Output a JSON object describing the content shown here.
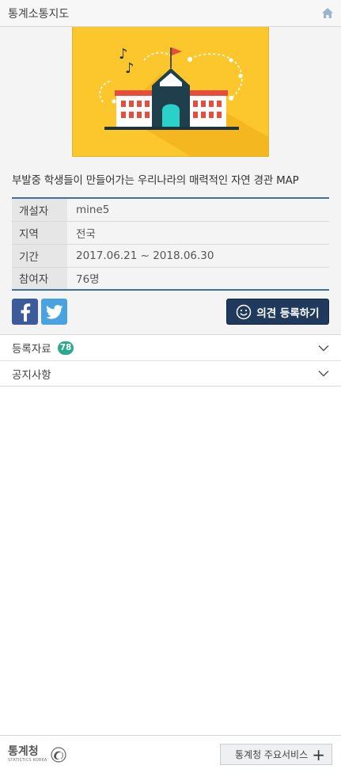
{
  "header": {
    "title": "통계소통지도"
  },
  "topic": {
    "title": "부발중 학생들이 만들어가는 우리나라의 매력적인 자연 경관 MAP"
  },
  "meta": [
    {
      "key": "개설자",
      "value": "mine5"
    },
    {
      "key": "지역",
      "value": "전국"
    },
    {
      "key": "기간",
      "value": "2017.06.21 ~ 2018.06.30"
    },
    {
      "key": "참여자",
      "value": "76명"
    }
  ],
  "actions": {
    "opinion_label": "의견 등록하기"
  },
  "accordion": {
    "registered_label": "등록자료",
    "registered_count": "78",
    "notice_label": "공지사항"
  },
  "footer": {
    "logo_main": "통계청",
    "logo_sub": "STATISTICS KOREA",
    "services_label": "통계청 주요서비스",
    "services_plus": "+"
  },
  "colors": {
    "accent_blue": "#3f6fa5",
    "button_navy": "#1f3a5c",
    "badge_green": "#2aa98c",
    "thumbnail_yellow": "#fcc72d",
    "facebook": "#3b5b9a",
    "twitter": "#4aa3e0"
  },
  "icons": [
    "home-icon",
    "school-illustration",
    "facebook-icon",
    "twitter-icon",
    "smiley-icon",
    "chevron-down-icon",
    "statistics-korea-emblem",
    "plus-icon"
  ]
}
